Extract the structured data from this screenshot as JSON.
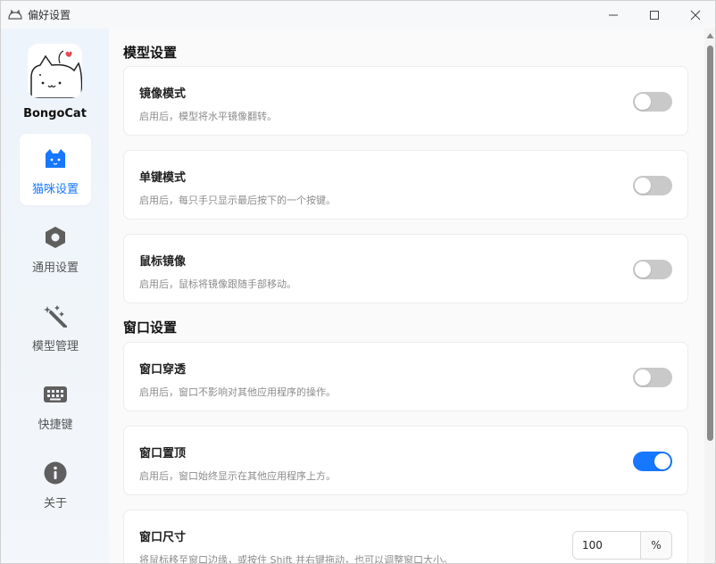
{
  "window": {
    "title": "偏好设置"
  },
  "sidebar": {
    "brand": "BongoCat",
    "items": [
      {
        "label": "猫咪设置",
        "icon": "cat-icon",
        "active": true
      },
      {
        "label": "通用设置",
        "icon": "hexagon-settings-icon",
        "active": false
      },
      {
        "label": "模型管理",
        "icon": "magic-wand-icon",
        "active": false
      },
      {
        "label": "快捷键",
        "icon": "keyboard-icon",
        "active": false
      },
      {
        "label": "关于",
        "icon": "info-icon",
        "active": false
      }
    ]
  },
  "sections": {
    "model": {
      "title": "模型设置",
      "mirror": {
        "title": "镜像模式",
        "desc": "启用后，模型将水平镜像翻转。",
        "enabled": false
      },
      "single_key": {
        "title": "单键模式",
        "desc": "启用后，每只手只显示最后按下的一个按键。",
        "enabled": false
      },
      "mouse_mirror": {
        "title": "鼠标镜像",
        "desc": "启用后，鼠标将镜像跟随手部移动。",
        "enabled": false
      }
    },
    "window": {
      "title": "窗口设置",
      "passthrough": {
        "title": "窗口穿透",
        "desc": "启用后，窗口不影响对其他应用程序的操作。",
        "enabled": false
      },
      "always_on_top": {
        "title": "窗口置顶",
        "desc": "启用后，窗口始终显示在其他应用程序上方。",
        "enabled": true
      },
      "size": {
        "title": "窗口尺寸",
        "desc": "将鼠标移至窗口边缘，或按住 Shift 并右键拖动，也可以调整窗口大小。",
        "value": "100",
        "unit": "%"
      }
    }
  },
  "colors": {
    "accent": "#1677ff",
    "toggle_off": "#c9c9c9"
  }
}
